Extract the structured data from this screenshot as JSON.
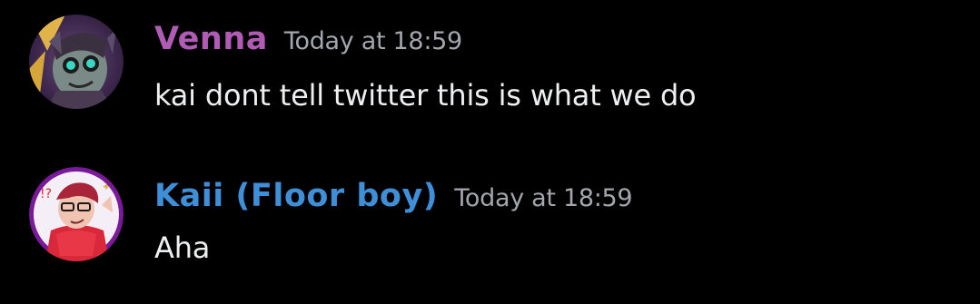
{
  "messages": [
    {
      "username": "Venna",
      "username_color": "#b05bb5",
      "timestamp": "Today at 18:59",
      "text": "kai dont tell twitter this is what we do",
      "avatar_icon": "user-avatar-venna"
    },
    {
      "username": "Kaii (Floor boy)",
      "username_color": "#3f8ed8",
      "timestamp": "Today at 18:59",
      "text": "Aha",
      "avatar_icon": "user-avatar-kaii"
    }
  ],
  "colors": {
    "background": "#000000",
    "timestamp": "#a3a6ad",
    "message_text": "#eeeff1"
  }
}
